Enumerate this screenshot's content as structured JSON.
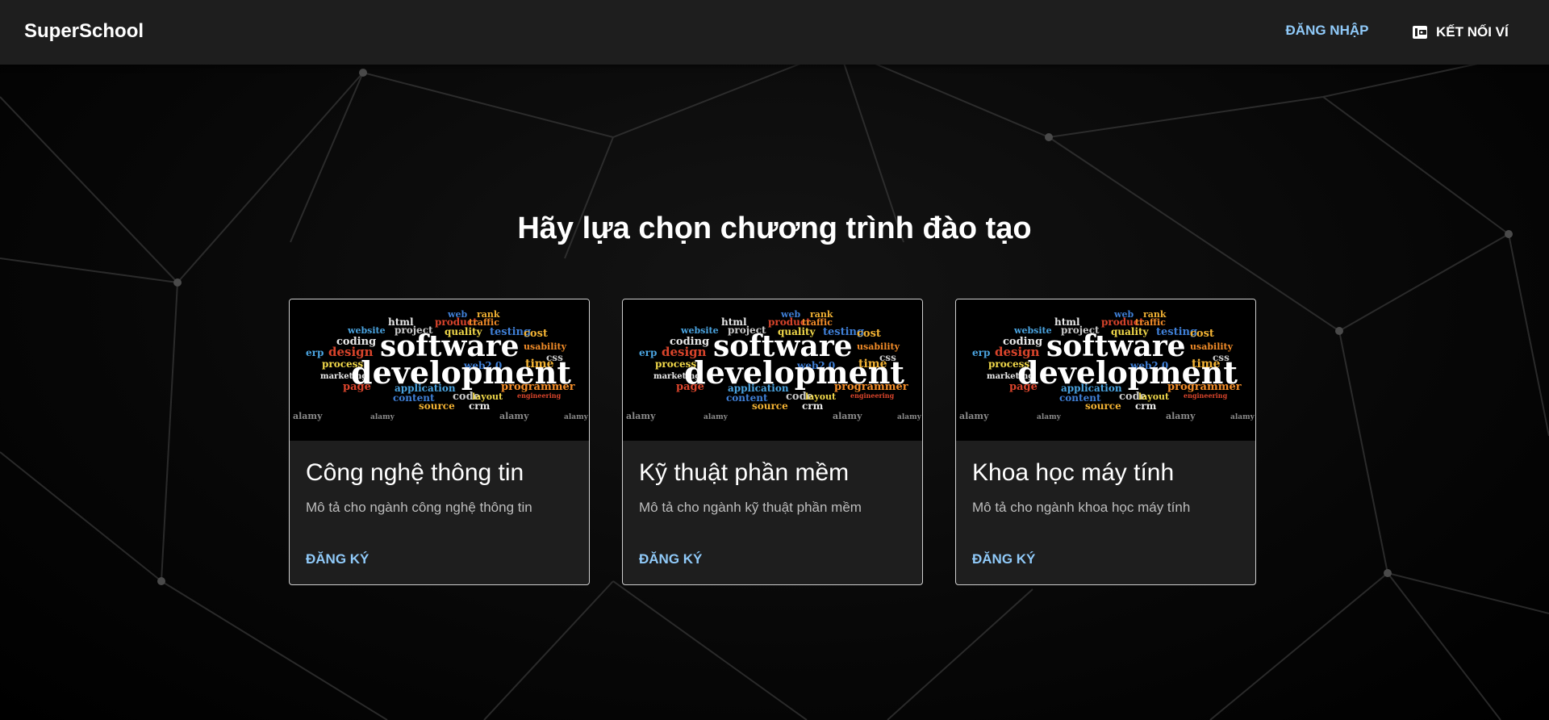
{
  "app": {
    "title": "SuperSchool"
  },
  "nav": {
    "login_label": "ĐĂNG NHẬP",
    "wallet_label": "KẾT NỐI VÍ",
    "wallet_icon": "wallet-icon"
  },
  "main": {
    "heading": "Hãy lựa chọn chương trình đào tạo",
    "cards": [
      {
        "title": "Công nghệ thông tin",
        "description": "Mô tả cho ngành công nghệ thông tin",
        "action": "ĐĂNG KÝ"
      },
      {
        "title": "Kỹ thuật phần mềm",
        "description": "Mô tả cho ngành kỹ thuật phần mềm",
        "action": "ĐĂNG KÝ"
      },
      {
        "title": "Khoa học máy tính",
        "description": "Mô tả cho ngành khoa học máy tính",
        "action": "ĐĂNG KÝ"
      }
    ],
    "card_image": {
      "words_large": [
        "software",
        "development"
      ],
      "words_small": [
        "web",
        "rank",
        "html",
        "product",
        "traffic",
        "website",
        "project",
        "quality",
        "testing",
        "cost",
        "coding",
        "design",
        "usability",
        "erp",
        "css",
        "process",
        "web2.0",
        "time",
        "marketing",
        "page",
        "programmer",
        "application",
        "code",
        "layout",
        "content",
        "source",
        "crm",
        "engineering",
        "alamy",
        "alamy",
        "alamy",
        "alamy"
      ]
    }
  },
  "theme": {
    "accent": "#90caf9",
    "appbar_bg": "#1e1e1e",
    "card_bg": "#1e1e1e",
    "card_border": "#cfcfcf"
  }
}
